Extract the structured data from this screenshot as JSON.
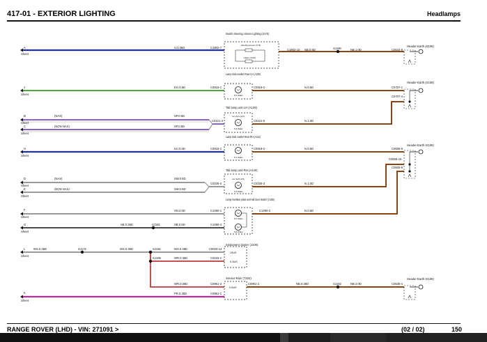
{
  "header": {
    "title": "417-01 - EXTERIOR LIGHTING",
    "section": "Headlamps"
  },
  "footer": {
    "vehicle": "RANGE ROVER  (LHD) - VIN: 271091 >",
    "page_of": "(02 / 02)",
    "page_number": "150"
  },
  "colors": {
    "blue": "#1f2fb0",
    "green": "#4caa3c",
    "violet": "#8a62c8",
    "brown": "#8b4513",
    "gray": "#9a9a9a",
    "black": "#111111",
    "red": "#c85050",
    "magenta": "#c4299b"
  },
  "labels": {
    "sheet": "Sheet",
    "l1_pin": "A",
    "l1_wire": "U.0.35D",
    "l1_conn": "C1802-7",
    "sw_title": "Switch-Steering column-Lighting (S175)",
    "sw_micro": "Micro/Dipped beam (T178)",
    "sw_flash": "Flash (T198)",
    "l1_c2": "C1802-10",
    "l1_w2": "NB.0.5D",
    "l1_sj": "SJ180",
    "l1_w3": "NB.1.0D",
    "l1_c3": "C0534-9",
    "he1": "Header-Earth (K108)",
    "l2_pin": "J",
    "l2_wire": "EG.0.5D",
    "l2_conn": "C0919-1",
    "lsm_lh_title": "Lamp-Side marker-Rear-LH (A135)",
    "lsm_lh_watt": "5.0 Watts",
    "l2_c2": "C0919-2",
    "l2_w2": "N.0.5D",
    "l2_c3": "C0707-1",
    "l2_c4": "C0707-4",
    "he2": "Header-Earth (K108)",
    "l3_pin": "B",
    "l3_nas": "(NAS)",
    "l3_wire": "SP.0.5D",
    "l4_pin": "C",
    "l4_nonnas": "(NON NAS)",
    "l4_wire": "SP.0.5D",
    "tl_lh_title": "Tail lamp unit-LH (A139)",
    "tl_lh_conn": "C0121-4",
    "tl_lh_inner": "Lamp-Tail LH (A176)",
    "tl_lh_watt": "5.0 Watts",
    "tl_lh_c2": "C0121-5",
    "tl_lh_w2": "N.1.0D",
    "l5_pin": "H",
    "l5_wire": "SU.0.5D",
    "l5_conn": "C0918-1",
    "lsm_rh_title": "Lamp-Side marker-Rear-RH (A134)",
    "lsm_rh_watt": "5.0 Watts",
    "l5_c2": "C0918-2",
    "l5_w2": "N.0.5D",
    "l5_c3": "C0505-5",
    "l5_c4": "C0505-15",
    "l5_c5": "C0505-9",
    "he3": "Header-Earth (K108)",
    "l6_pin": "D",
    "l6_nas": "(NAS)",
    "l6_wire": "SW.0.5D",
    "l7_pin": "E",
    "l7_nonnas": "(NON NAS)",
    "l7_wire": "SW.0.5D",
    "tl_rh_title": "Tail lamp unit-RH (A140)",
    "tl_rh_conn": "C0105-4",
    "tl_rh_inner": "Lamp-Tail RH (A181)",
    "tl_rh_watt": "5.0 Watts",
    "tl_rh_c2": "C0105-3",
    "tl_rh_w2": "N.1.0D",
    "l8_pin": "F",
    "l8_wire": "SN.0.5D",
    "l8_conn": "C1490-1",
    "np_title": "Lamp-Number plate and-tail door switch (A155)",
    "np_watt1": "5.0 Watts",
    "np_watt2": "5.0 Watts",
    "l8_c2": "C1490-2",
    "l8_w2": "N.0.5D",
    "l9_pin": "G",
    "l9_w1": "SB.0.35D",
    "l9_sj": "SJ181",
    "l9_w2": "SB.0.5D",
    "l9_conn": "C1490-4",
    "l10_pin": "L",
    "l10_w1": "WS.0.35D",
    "l10_sj1": "SJ172",
    "l10_w2": "WS.0.35D",
    "l10_sj2": "SJ191",
    "l10_w3": "WS.0.35D",
    "l10_conn": "C0033-14",
    "ic_title": "Instrument cluster (J100)",
    "ic_ibus": "I-BUS",
    "ic_kbus": "K-BUS",
    "l11_sj": "SJ195",
    "l11_w": "WR.0.35D",
    "l11_conn": "C0233-1",
    "l12_w": "WR.0.35D",
    "l12_conn": "C0961-3",
    "rs_title": "Sensor-Rain (T204)",
    "rs_kbus": "K BUS",
    "l12_c2": "C0961-2",
    "l12_w2": "NB.0.35D",
    "l12_sj": "SJ182",
    "l12_w3": "NB.2.0D",
    "l12_c3": "C0535-4",
    "he4": "Header-Earth (K108)",
    "l13_pin": "K",
    "l13_wire": "PR.0.35D",
    "l13_conn": "C0961-1"
  }
}
